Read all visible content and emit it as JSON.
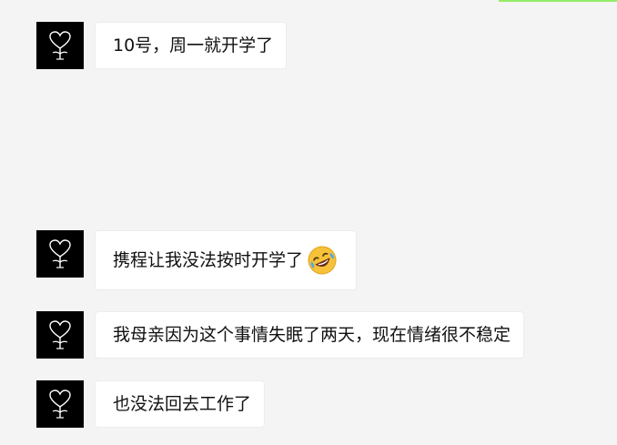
{
  "messages": [
    {
      "text": "10号，周一就开学了",
      "emoji": null
    },
    {
      "text": "携程让我没法按时开学了",
      "emoji": "rolling-on-floor-laughing-emoji"
    },
    {
      "text": "我母亲因为这个事情失眠了两天，现在情绪很不稳定",
      "emoji": null
    },
    {
      "text": "也没法回去工作了",
      "emoji": null
    }
  ],
  "colors": {
    "background": "#f4f4f4",
    "bubble": "#ffffff",
    "avatar": "#000000",
    "accent": "#95ec69"
  },
  "icons": {
    "avatar": "heart-flower-icon"
  }
}
